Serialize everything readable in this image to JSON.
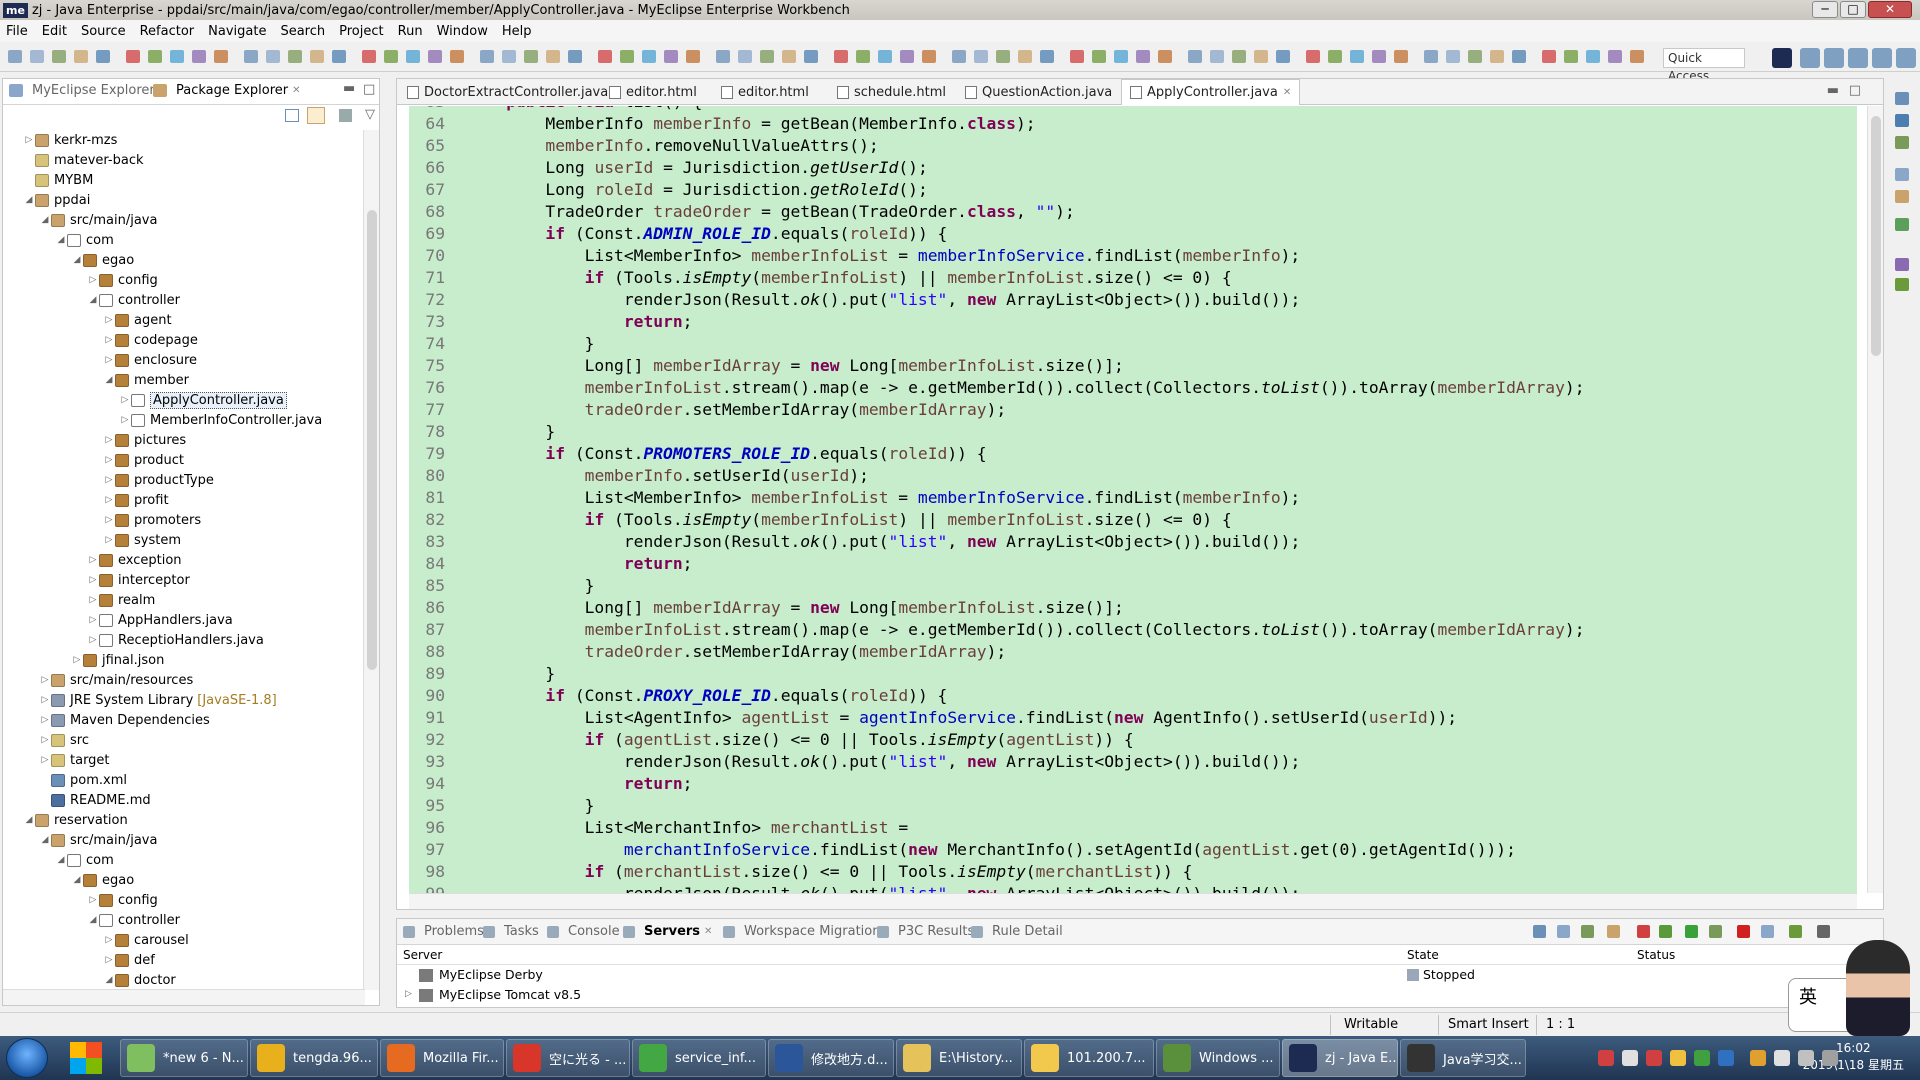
{
  "window": {
    "title": "zj - Java Enterprise - ppdai/src/main/java/com/egao/controller/member/ApplyController.java - MyEclipse Enterprise Workbench",
    "logo": "me",
    "minimize": "─",
    "maximize": "□",
    "close": "✕"
  },
  "menu": [
    "File",
    "Edit",
    "Source",
    "Refactor",
    "Navigate",
    "Search",
    "Project",
    "Run",
    "Window",
    "Help"
  ],
  "quick_access": "Quick Access",
  "explorer": {
    "tabs": [
      {
        "label": "MyEclipse Explorer"
      },
      {
        "label": "Package Explorer",
        "close": "✕"
      }
    ],
    "items": [
      {
        "label": "kerkr-mzs",
        "depth": 0,
        "arrow": "▷",
        "icon": "project"
      },
      {
        "label": "matever-back",
        "depth": 0,
        "arrow": "",
        "icon": "folder"
      },
      {
        "label": "MYBM",
        "depth": 0,
        "arrow": "",
        "icon": "folder"
      },
      {
        "label": "ppdai",
        "depth": 0,
        "arrow": "◢",
        "icon": "project"
      },
      {
        "label": "src/main/java",
        "depth": 1,
        "arrow": "◢",
        "icon": "srcfolder"
      },
      {
        "label": "com",
        "depth": 2,
        "arrow": "◢",
        "icon": "package-empty"
      },
      {
        "label": "egao",
        "depth": 3,
        "arrow": "◢",
        "icon": "package"
      },
      {
        "label": "config",
        "depth": 4,
        "arrow": "▷",
        "icon": "package"
      },
      {
        "label": "controller",
        "depth": 4,
        "arrow": "◢",
        "icon": "package-empty"
      },
      {
        "label": "agent",
        "depth": 5,
        "arrow": "▷",
        "icon": "package"
      },
      {
        "label": "codepage",
        "depth": 5,
        "arrow": "▷",
        "icon": "package"
      },
      {
        "label": "enclosure",
        "depth": 5,
        "arrow": "▷",
        "icon": "package"
      },
      {
        "label": "member",
        "depth": 5,
        "arrow": "◢",
        "icon": "package"
      },
      {
        "label": "ApplyController.java",
        "depth": 6,
        "arrow": "▷",
        "icon": "java",
        "selected": true
      },
      {
        "label": "MemberInfoController.java",
        "depth": 6,
        "arrow": "▷",
        "icon": "java"
      },
      {
        "label": "pictures",
        "depth": 5,
        "arrow": "▷",
        "icon": "package"
      },
      {
        "label": "product",
        "depth": 5,
        "arrow": "▷",
        "icon": "package"
      },
      {
        "label": "productType",
        "depth": 5,
        "arrow": "▷",
        "icon": "package"
      },
      {
        "label": "profit",
        "depth": 5,
        "arrow": "▷",
        "icon": "package"
      },
      {
        "label": "promoters",
        "depth": 5,
        "arrow": "▷",
        "icon": "package"
      },
      {
        "label": "system",
        "depth": 5,
        "arrow": "▷",
        "icon": "package"
      },
      {
        "label": "exception",
        "depth": 4,
        "arrow": "▷",
        "icon": "package"
      },
      {
        "label": "interceptor",
        "depth": 4,
        "arrow": "▷",
        "icon": "package"
      },
      {
        "label": "realm",
        "depth": 4,
        "arrow": "▷",
        "icon": "package"
      },
      {
        "label": "AppHandlers.java",
        "depth": 4,
        "arrow": "▷",
        "icon": "java"
      },
      {
        "label": "ReceptioHandlers.java",
        "depth": 4,
        "arrow": "▷",
        "icon": "java"
      },
      {
        "label": "jfinal.json",
        "depth": 3,
        "arrow": "▷",
        "icon": "package"
      },
      {
        "label": "src/main/resources",
        "depth": 1,
        "arrow": "▷",
        "icon": "srcfolder"
      },
      {
        "label": "JRE System Library",
        "suffix": "[JavaSE-1.8]",
        "depth": 1,
        "arrow": "▷",
        "icon": "library"
      },
      {
        "label": "Maven Dependencies",
        "depth": 1,
        "arrow": "▷",
        "icon": "library"
      },
      {
        "label": "src",
        "depth": 1,
        "arrow": "▷",
        "icon": "folder"
      },
      {
        "label": "target",
        "depth": 1,
        "arrow": "▷",
        "icon": "folder"
      },
      {
        "label": "pom.xml",
        "depth": 1,
        "arrow": "",
        "icon": "xml"
      },
      {
        "label": "README.md",
        "depth": 1,
        "arrow": "",
        "icon": "md"
      },
      {
        "label": "reservation",
        "depth": 0,
        "arrow": "◢",
        "icon": "project"
      },
      {
        "label": "src/main/java",
        "depth": 1,
        "arrow": "◢",
        "icon": "srcfolder"
      },
      {
        "label": "com",
        "depth": 2,
        "arrow": "◢",
        "icon": "package-empty"
      },
      {
        "label": "egao",
        "depth": 3,
        "arrow": "◢",
        "icon": "package"
      },
      {
        "label": "config",
        "depth": 4,
        "arrow": "▷",
        "icon": "package"
      },
      {
        "label": "controller",
        "depth": 4,
        "arrow": "◢",
        "icon": "package-empty"
      },
      {
        "label": "carousel",
        "depth": 5,
        "arrow": "▷",
        "icon": "package"
      },
      {
        "label": "def",
        "depth": 5,
        "arrow": "▷",
        "icon": "package"
      },
      {
        "label": "doctor",
        "depth": 5,
        "arrow": "◢",
        "icon": "package"
      }
    ]
  },
  "editor": {
    "tabs": [
      {
        "label": "DoctorExtractController.java"
      },
      {
        "label": "editor.html"
      },
      {
        "label": "editor.html"
      },
      {
        "label": "schedule.html"
      },
      {
        "label": "QuestionAction.java"
      },
      {
        "label": "ApplyController.java",
        "active": true,
        "close": "✕"
      }
    ],
    "lines": [
      {
        "n": "63",
        "code": "    public void list() {"
      },
      {
        "n": "64",
        "code": "        MemberInfo memberInfo = getBean(MemberInfo.class);"
      },
      {
        "n": "65",
        "code": "        memberInfo.removeNullValueAttrs();"
      },
      {
        "n": "66",
        "code": "        Long userId = Jurisdiction.getUserId();"
      },
      {
        "n": "67",
        "code": "        Long roleId = Jurisdiction.getRoleId();"
      },
      {
        "n": "68",
        "code": "        TradeOrder tradeOrder = getBean(TradeOrder.class, \"\");"
      },
      {
        "n": "69",
        "code": "        if (Const.ADMIN_ROLE_ID.equals(roleId)) {"
      },
      {
        "n": "70",
        "code": "            List<MemberInfo> memberInfoList = memberInfoService.findList(memberInfo);"
      },
      {
        "n": "71",
        "code": "            if (Tools.isEmpty(memberInfoList) || memberInfoList.size() <= 0) {"
      },
      {
        "n": "72",
        "code": "                renderJson(Result.ok().put(\"list\", new ArrayList<Object>()).build());"
      },
      {
        "n": "73",
        "code": "                return;"
      },
      {
        "n": "74",
        "code": "            }"
      },
      {
        "n": "75",
        "code": "            Long[] memberIdArray = new Long[memberInfoList.size()];"
      },
      {
        "n": "76",
        "code": "            memberInfoList.stream().map(e -> e.getMemberId()).collect(Collectors.toList()).toArray(memberIdArray);"
      },
      {
        "n": "77",
        "code": "            tradeOrder.setMemberIdArray(memberIdArray);"
      },
      {
        "n": "78",
        "code": "        }"
      },
      {
        "n": "79",
        "code": "        if (Const.PROMOTERS_ROLE_ID.equals(roleId)) {"
      },
      {
        "n": "80",
        "code": "            memberInfo.setUserId(userId);"
      },
      {
        "n": "81",
        "code": "            List<MemberInfo> memberInfoList = memberInfoService.findList(memberInfo);"
      },
      {
        "n": "82",
        "code": "            if (Tools.isEmpty(memberInfoList) || memberInfoList.size() <= 0) {"
      },
      {
        "n": "83",
        "code": "                renderJson(Result.ok().put(\"list\", new ArrayList<Object>()).build());"
      },
      {
        "n": "84",
        "code": "                return;"
      },
      {
        "n": "85",
        "code": "            }"
      },
      {
        "n": "86",
        "code": "            Long[] memberIdArray = new Long[memberInfoList.size()];"
      },
      {
        "n": "87",
        "code": "            memberInfoList.stream().map(e -> e.getMemberId()).collect(Collectors.toList()).toArray(memberIdArray);"
      },
      {
        "n": "88",
        "code": "            tradeOrder.setMemberIdArray(memberIdArray);"
      },
      {
        "n": "89",
        "code": "        }"
      },
      {
        "n": "90",
        "code": "        if (Const.PROXY_ROLE_ID.equals(roleId)) {"
      },
      {
        "n": "91",
        "code": "            List<AgentInfo> agentList = agentInfoService.findList(new AgentInfo().setUserId(userId));"
      },
      {
        "n": "92",
        "code": "            if (agentList.size() <= 0 || Tools.isEmpty(agentList)) {"
      },
      {
        "n": "93",
        "code": "                renderJson(Result.ok().put(\"list\", new ArrayList<Object>()).build());"
      },
      {
        "n": "94",
        "code": "                return;"
      },
      {
        "n": "95",
        "code": "            }"
      },
      {
        "n": "96",
        "code": "            List<MerchantInfo> merchantList ="
      },
      {
        "n": "97",
        "code": "                merchantInfoService.findList(new MerchantInfo().setAgentId(agentList.get(0).getAgentId()));"
      },
      {
        "n": "98",
        "code": "            if (merchantList.size() <= 0 || Tools.isEmpty(merchantList)) {"
      },
      {
        "n": "99",
        "code": "                renderJson(Result.ok().put(\"list\", new ArrayList<Object>()).build());"
      }
    ]
  },
  "bottom": {
    "tabs": [
      {
        "label": "Problems"
      },
      {
        "label": "Tasks"
      },
      {
        "label": "Console"
      },
      {
        "label": "Servers",
        "active": true,
        "close": "✕"
      },
      {
        "label": "Workspace Migration"
      },
      {
        "label": "P3C Results"
      },
      {
        "label": "Rule Detail"
      }
    ],
    "columns": [
      "Server",
      "State",
      "Status"
    ],
    "servers": [
      {
        "name": "MyEclipse Derby",
        "state": "Stopped"
      },
      {
        "name": "MyEclipse Tomcat v8.5",
        "state": ""
      }
    ]
  },
  "statusbar": {
    "mode": "Writable",
    "insert": "Smart Insert",
    "position": "1 : 1"
  },
  "taskbar": {
    "tasks": [
      {
        "label": "*new 6 - N...",
        "color": "#7fbf5f"
      },
      {
        "label": "tengda.96...",
        "color": "#e8b01c"
      },
      {
        "label": "Mozilla Fir...",
        "color": "#e66a1f"
      },
      {
        "label": "空に光る - ...",
        "color": "#d8362b"
      },
      {
        "label": "service_inf...",
        "color": "#43a844"
      },
      {
        "label": "修改地方.d...",
        "color": "#2b579a"
      },
      {
        "label": "E:\\History...",
        "color": "#e6c25a"
      },
      {
        "label": "101.200.7...",
        "color": "#f2c94c"
      },
      {
        "label": "Windows ...",
        "color": "#5a8f3c"
      },
      {
        "label": "zj - Java E...",
        "color": "#1d2a52",
        "active": true
      },
      {
        "label": "Java学习交...",
        "color": "#333333"
      }
    ],
    "time": "16:02",
    "date": "2019\\1\\18 星期五"
  },
  "ime": "英"
}
